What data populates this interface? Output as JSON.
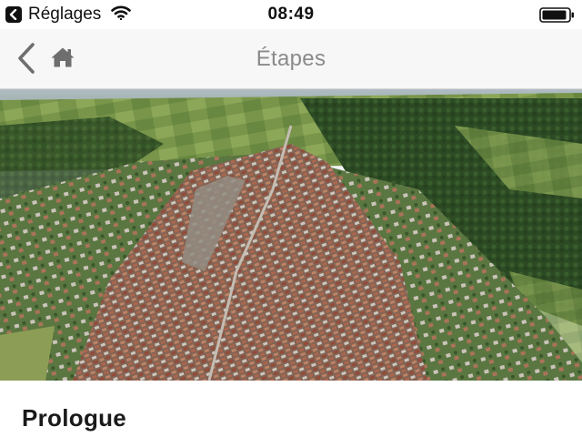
{
  "status_bar": {
    "back_app_label": "Réglages",
    "time": "08:49"
  },
  "nav": {
    "title": "Étapes",
    "back_icon": "chevron-left-icon",
    "home_icon": "home-icon"
  },
  "hero": {
    "alt": "aerial-city-photo"
  },
  "content": {
    "section_title": "Prologue"
  },
  "colors": {
    "nav_background": "#f7f7f7",
    "nav_icon": "#6e6e6e",
    "title_gray": "#8a8a8a"
  }
}
